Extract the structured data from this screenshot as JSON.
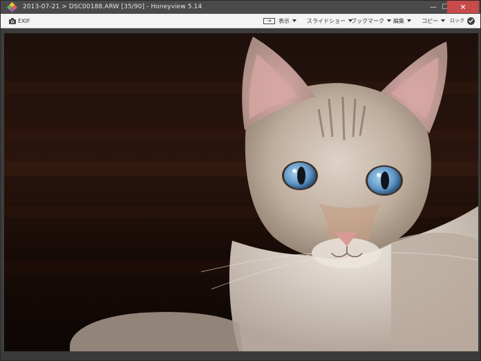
{
  "window": {
    "title": "2013-07-21 > DSC00188.ARW [35/90] - Honeyview 5.14",
    "icon": "honeyview-app-icon",
    "controls": {
      "minimize": "—",
      "maximize": "☐",
      "close": "✕"
    }
  },
  "toolbar": {
    "exif_label": "EXIF",
    "fit_label": "⇥",
    "menus": {
      "view": "表示",
      "slideshow": "スライドショー",
      "bookmark": "ブックマーク",
      "edit": "編集",
      "copy": "コピー",
      "lock": "ロック"
    }
  },
  "viewer": {
    "image_subject": "cat-photo",
    "colors": {
      "background": "#1a0d09",
      "fur": "#c9b8a8",
      "eye": "#6fa7d6",
      "nose": "#d99a95"
    }
  }
}
